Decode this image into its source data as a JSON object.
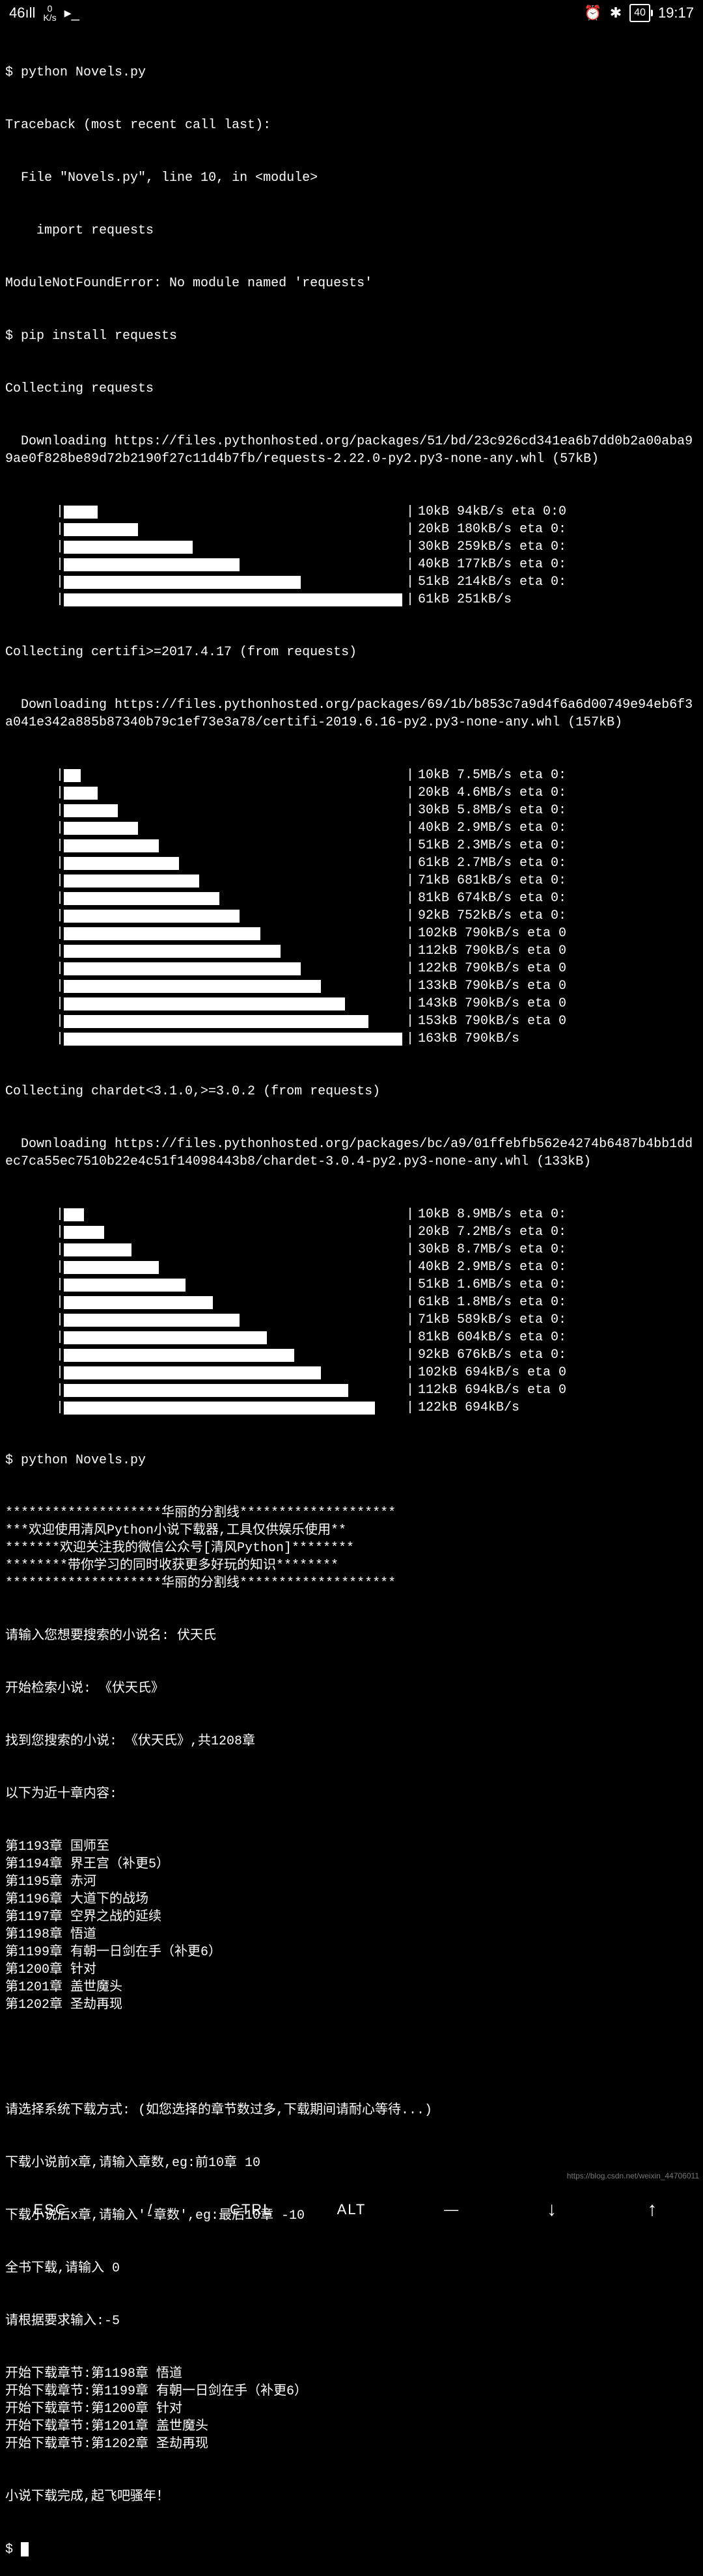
{
  "status": {
    "signal": "46ıll",
    "net_speed": "0",
    "net_unit": "K/s",
    "alarm_icon": "⏰",
    "bt_icon": "✱",
    "battery": "40",
    "time": "19:17"
  },
  "terminal": {
    "prompt": "$ ",
    "cmd1": "python Novels.py",
    "traceback1": "Traceback (most recent call last):",
    "traceback2": "  File \"Novels.py\", line 10, in <module>",
    "traceback3": "    import requests",
    "traceback4": "ModuleNotFoundError: No module named 'requests'",
    "cmd2": "pip install requests",
    "collect1": "Collecting requests",
    "dl1": "  Downloading https://files.pythonhosted.org/packages/51/bd/23c926cd341ea6b7dd0b2a00aba99ae0f828be89d72b2190f27c11d4b7fb/requests-2.22.0-py2.py3-none-any.whl (57kB)",
    "progress1": [
      {
        "pct": 10,
        "stats": "10kB 94kB/s eta 0:0"
      },
      {
        "pct": 22,
        "stats": "20kB 180kB/s eta 0:"
      },
      {
        "pct": 38,
        "stats": "30kB 259kB/s eta 0:"
      },
      {
        "pct": 52,
        "stats": "40kB 177kB/s eta 0:"
      },
      {
        "pct": 70,
        "stats": "51kB 214kB/s eta 0:"
      },
      {
        "pct": 100,
        "stats": "61kB 251kB/s"
      }
    ],
    "collect2": "Collecting certifi>=2017.4.17 (from requests)",
    "dl2": "  Downloading https://files.pythonhosted.org/packages/69/1b/b853c7a9d4f6a6d00749e94eb6f3a041e342a885b87340b79c1ef73e3a78/certifi-2019.6.16-py2.py3-none-any.whl (157kB)",
    "progress2": [
      {
        "pct": 5,
        "stats": "10kB 7.5MB/s eta 0:"
      },
      {
        "pct": 10,
        "stats": "20kB 4.6MB/s eta 0:"
      },
      {
        "pct": 16,
        "stats": "30kB 5.8MB/s eta 0:"
      },
      {
        "pct": 22,
        "stats": "40kB 2.9MB/s eta 0:"
      },
      {
        "pct": 28,
        "stats": "51kB 2.3MB/s eta 0:"
      },
      {
        "pct": 34,
        "stats": "61kB 2.7MB/s eta 0:"
      },
      {
        "pct": 40,
        "stats": "71kB 681kB/s eta 0:"
      },
      {
        "pct": 46,
        "stats": "81kB 674kB/s eta 0:"
      },
      {
        "pct": 52,
        "stats": "92kB 752kB/s eta 0:"
      },
      {
        "pct": 58,
        "stats": "102kB 790kB/s eta 0"
      },
      {
        "pct": 64,
        "stats": "112kB 790kB/s eta 0"
      },
      {
        "pct": 70,
        "stats": "122kB 790kB/s eta 0"
      },
      {
        "pct": 76,
        "stats": "133kB 790kB/s eta 0"
      },
      {
        "pct": 83,
        "stats": "143kB 790kB/s eta 0"
      },
      {
        "pct": 90,
        "stats": "153kB 790kB/s eta 0"
      },
      {
        "pct": 100,
        "stats": "163kB 790kB/s"
      }
    ],
    "collect3": "Collecting chardet<3.1.0,>=3.0.2 (from requests)",
    "dl3": "  Downloading https://files.pythonhosted.org/packages/bc/a9/01ffebfb562e4274b6487b4bb1ddec7ca55ec7510b22e4c51f14098443b8/chardet-3.0.4-py2.py3-none-any.whl (133kB)",
    "progress3": [
      {
        "pct": 6,
        "stats": "10kB 8.9MB/s eta 0:"
      },
      {
        "pct": 12,
        "stats": "20kB 7.2MB/s eta 0:"
      },
      {
        "pct": 20,
        "stats": "30kB 8.7MB/s eta 0:"
      },
      {
        "pct": 28,
        "stats": "40kB 2.9MB/s eta 0:"
      },
      {
        "pct": 36,
        "stats": "51kB 1.6MB/s eta 0:"
      },
      {
        "pct": 44,
        "stats": "61kB 1.8MB/s eta 0:"
      },
      {
        "pct": 52,
        "stats": "71kB 589kB/s eta 0:"
      },
      {
        "pct": 60,
        "stats": "81kB 604kB/s eta 0:"
      },
      {
        "pct": 68,
        "stats": "92kB 676kB/s eta 0:"
      },
      {
        "pct": 76,
        "stats": "102kB 694kB/s eta 0"
      },
      {
        "pct": 84,
        "stats": "112kB 694kB/s eta 0"
      },
      {
        "pct": 92,
        "stats": "122kB 694kB/s"
      }
    ],
    "cmd3": "python Novels.py",
    "banner": [
      "********************华丽的分割线********************",
      "***欢迎使用清风Python小说下载器,工具仅供娱乐使用**",
      "*******欢迎关注我的微信公众号[清风Python]********",
      "********带你学习的同时收获更多好玩的知识********",
      "********************华丽的分割线********************"
    ],
    "input_prompt": "请输入您想要搜索的小说名: 伏天氏",
    "search_start": "开始检索小说: 《伏天氏》",
    "found": "找到您搜索的小说: 《伏天氏》,共1208章",
    "recent_header": "以下为近十章内容:",
    "chapters": [
      "第1193章 国师至",
      "第1194章 界王宫（补更5）",
      "第1195章 赤河",
      "第1196章 大道下的战场",
      "第1197章 空界之战的延续",
      "第1198章 悟道",
      "第1199章 有朝一日剑在手（补更6）",
      "第1200章 针对",
      "第1201章 盖世魔头",
      "第1202章 圣劫再现"
    ],
    "blank": "",
    "dl_prompt": "请选择系统下载方式: (如您选择的章节数过多,下载期间请耐心等待...)",
    "hint1": "下载小说前x章,请输入章数,eg:前10章 10",
    "hint2": "下载小说后x章,请输入'-章数',eg:最后10章 -10",
    "hint3": "全书下载,请输入 0",
    "user_input": "请根据要求输入:-5",
    "downloads": [
      "开始下载章节:第1198章 悟道",
      "开始下载章节:第1199章 有朝一日剑在手（补更6）",
      "开始下载章节:第1200章 针对",
      "开始下载章节:第1201章 盖世魔头",
      "开始下载章节:第1202章 圣劫再现"
    ],
    "done": "小说下载完成,起飞吧骚年！"
  },
  "watermark": "https://blog.csdn.net/weixin_44706011",
  "bottom": {
    "esc": "ESC",
    "ctrl": "CTRL",
    "alt": "ALT",
    "down": "↓",
    "up": "↑"
  }
}
